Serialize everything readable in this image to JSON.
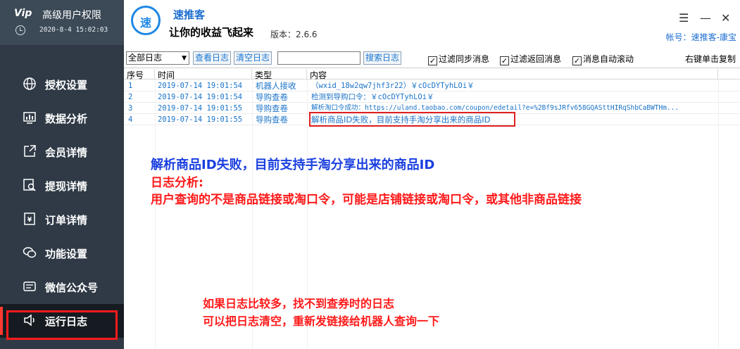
{
  "sidebar": {
    "logo_text": "Vip",
    "title": "高级用户权限",
    "datetime": "2020-8-4 15:02:03",
    "items": [
      {
        "label": "授权设置",
        "icon": "globe-icon"
      },
      {
        "label": "数据分析",
        "icon": "chart-icon"
      },
      {
        "label": "会员详情",
        "icon": "external-link-icon"
      },
      {
        "label": "提现详情",
        "icon": "search-doc-icon"
      },
      {
        "label": "订单详情",
        "icon": "receipt-icon"
      },
      {
        "label": "功能设置",
        "icon": "chat-icon"
      },
      {
        "label": "微信公众号",
        "icon": "wechat-icon"
      },
      {
        "label": "运行日志",
        "icon": "speaker-icon"
      }
    ],
    "active_index": 7
  },
  "header": {
    "logo_char": "速",
    "app_name": "速推客",
    "slogan": "让你的收益飞起来",
    "version": "版本：2.6.6",
    "account": "帐号：速推客-康宝",
    "menu_icon": "☰",
    "minimize_icon": "—",
    "close_icon": "✕"
  },
  "toolbar": {
    "filter_value": "全部日志",
    "view_logs": "查看日志",
    "clear_logs": "清空日志",
    "search_value": "",
    "search_button": "搜索日志",
    "check_sync": "过滤同步消息",
    "check_return": "过滤返回消息",
    "check_autoscroll": "消息自动滚动",
    "copy_hint": "右键单击复制"
  },
  "table": {
    "columns": [
      "序号",
      "时间",
      "类型",
      "内容"
    ],
    "rows": [
      {
        "no": "1",
        "time": "2019-07-14 19:01:54",
        "type": "机器人接收",
        "content": "（wxid_18w2qw7jhf3r22）￥cOcDYTyhLOi￥"
      },
      {
        "no": "2",
        "time": "2019-07-14 19:01:54",
        "type": "导购查卷",
        "content": "检测到导购口令：￥cOcDYTyhLOi￥"
      },
      {
        "no": "3",
        "time": "2019-07-14 19:01:55",
        "type": "导购查卷",
        "content": "解析淘口令成功：https://uland.taobao.com/coupon/edetail?e=%2Bf9sJRfv658GQASttHIRqShbCaBWTHm..."
      },
      {
        "no": "4",
        "time": "2019-07-14 19:01:55",
        "type": "导购查卷",
        "content": "解析商品ID失败，目前支持手淘分享出来的商品ID"
      }
    ]
  },
  "annotations": {
    "line1": "解析商品ID失败，目前支持手淘分享出来的商品ID",
    "line2": "日志分析:",
    "line3": "用户查询的不是商品链接或淘口令，可能是店铺链接或淘口令，或其他非商品链接",
    "line4": "如果日志比较多，找不到查券时的日志",
    "line5": "可以把日志清空，重新发链接给机器人查询一下"
  },
  "colors": {
    "sidebar_bg": "#2f3a46",
    "brand_bg": "#3c4a57",
    "active_bg": "#161b21",
    "accent_blue": "#1a73c8",
    "annotation_blue": "#1a3fe0",
    "annotation_red": "#ff1a1a"
  }
}
